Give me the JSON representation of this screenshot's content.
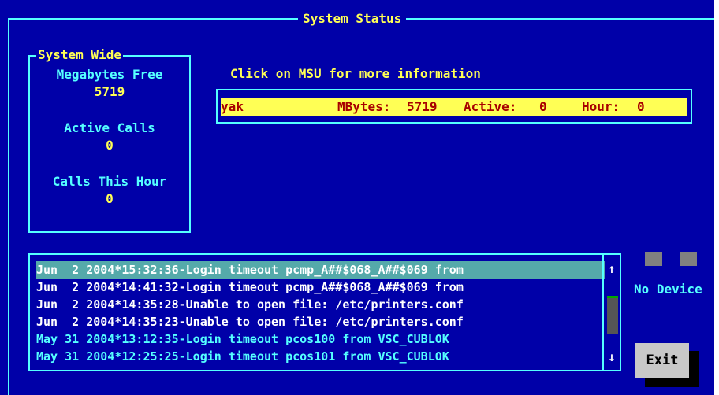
{
  "window": {
    "title": "System Status"
  },
  "system_wide": {
    "title": "System Wide",
    "megabytes_free_label": "Megabytes Free",
    "megabytes_free_value": "5719",
    "active_calls_label": "Active Calls",
    "active_calls_value": "0",
    "calls_this_hour_label": "Calls This Hour",
    "calls_this_hour_value": "0"
  },
  "msu": {
    "hint": "Click on MSU for more information",
    "entries": [
      {
        "name": "yak",
        "mbytes_label": "MBytes:",
        "mbytes_value": "5719",
        "active_label": "Active:",
        "active_value": "0",
        "hour_label": "Hour:",
        "hour_value": "0"
      }
    ]
  },
  "log": {
    "lines": [
      "Jun  2 2004*15:32:36-Login timeout pcmp_A##$068_A##$069 from",
      "Jun  2 2004*14:41:32-Login timeout pcmp_A##$068_A##$069 from",
      "Jun  2 2004*14:35:28-Unable to open file: /etc/printers.conf",
      "Jun  2 2004*14:35:23-Unable to open file: /etc/printers.conf",
      "May 31 2004*13:12:35-Login timeout pcos100 from VSC_CUBLOK",
      "May 31 2004*12:25:25-Login timeout pcos101 from VSC_CUBLOK"
    ],
    "selected_index": 0,
    "scroll_up": "↑",
    "scroll_down": "↓"
  },
  "device": {
    "status": "No Device"
  },
  "actions": {
    "exit_label": "Exit"
  },
  "colors": {
    "background": "#0000a8",
    "frame": "#55ffff",
    "text_yellow": "#ffff55",
    "msu_row": "#ffff55",
    "msu_text": "#a80000",
    "selected_row": "#55aaaa"
  }
}
